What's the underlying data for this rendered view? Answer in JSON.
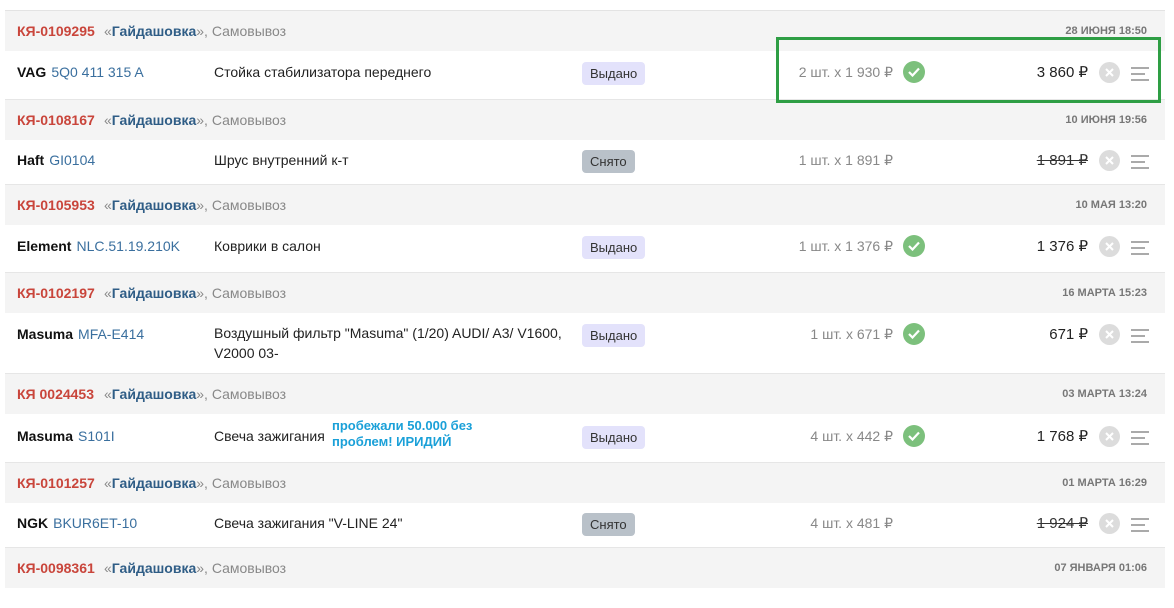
{
  "orders": [
    {
      "id": "КЯ-0109295",
      "store": "Гайдашовка",
      "delivery": "Самовывоз",
      "date": "28 ИЮНЯ 18:50",
      "brand": "VAG",
      "article": "5Q0 411 315 A",
      "description": "Стойка стабилизатора переднего",
      "comment": "",
      "status": "Выдано",
      "qty": "2 шт. x 1 930 ₽",
      "total": "3 860 ₽",
      "status_type": "issued"
    },
    {
      "id": "КЯ-0108167",
      "store": "Гайдашовка",
      "delivery": "Самовывоз",
      "date": "10 ИЮНЯ 19:56",
      "brand": "Haft",
      "article": "GI0104",
      "description": "Шрус внутренний к-т",
      "comment": "",
      "status": "Снято",
      "qty": "1 шт. x 1 891 ₽",
      "total": "1 891 ₽",
      "status_type": "removed"
    },
    {
      "id": "КЯ-0105953",
      "store": "Гайдашовка",
      "delivery": "Самовывоз",
      "date": "10 МАЯ 13:20",
      "brand": "Element",
      "article": "NLC.51.19.210K",
      "description": "Коврики в салон",
      "comment": "",
      "status": "Выдано",
      "qty": "1 шт. x 1 376 ₽",
      "total": "1 376 ₽",
      "status_type": "issued"
    },
    {
      "id": "КЯ-0102197",
      "store": "Гайдашовка",
      "delivery": "Самовывоз",
      "date": "16 МАРТА 15:23",
      "brand": "Masuma",
      "article": "MFA-E414",
      "description": "Воздушный фильтр \"Masuma\" (1/20) AUDI/ A3/ V1600, V2000 03-",
      "comment": "",
      "status": "Выдано",
      "qty": "1 шт. x 671 ₽",
      "total": "671 ₽",
      "status_type": "issued"
    },
    {
      "id": "КЯ 0024453",
      "store": "Гайдашовка",
      "delivery": "Самовывоз",
      "date": "03 МАРТА 13:24",
      "brand": "Masuma",
      "article": "S101I",
      "description": "Свеча зажигания",
      "comment": "пробежали 50.000 без проблем! ИРИДИЙ",
      "status": "Выдано",
      "qty": "4 шт. x 442 ₽",
      "total": "1 768 ₽",
      "status_type": "issued"
    },
    {
      "id": "КЯ-0101257",
      "store": "Гайдашовка",
      "delivery": "Самовывоз",
      "date": "01 МАРТА 16:29",
      "brand": "NGK",
      "article": "BKUR6ET-10",
      "description": "Свеча зажигания \"V-LINE 24\"",
      "comment": "",
      "status": "Снято",
      "qty": "4 шт. x 481 ₽",
      "total": "1 924 ₽",
      "status_type": "removed"
    },
    {
      "id": "КЯ-0098361",
      "store": "Гайдашовка",
      "delivery": "Самовывоз",
      "date": "07 ЯНВАРЯ 01:06"
    }
  ],
  "colors": {
    "order_id": "#c9453b",
    "store": "#2f5d86",
    "article": "#3a6f9e",
    "comment": "#1aa0d8",
    "check": "#7cc07c",
    "highlight": "#2e9e44"
  },
  "icons": {
    "check": "check-circle-icon",
    "cancel": "x-circle-icon",
    "menu": "menu-lines-icon"
  }
}
